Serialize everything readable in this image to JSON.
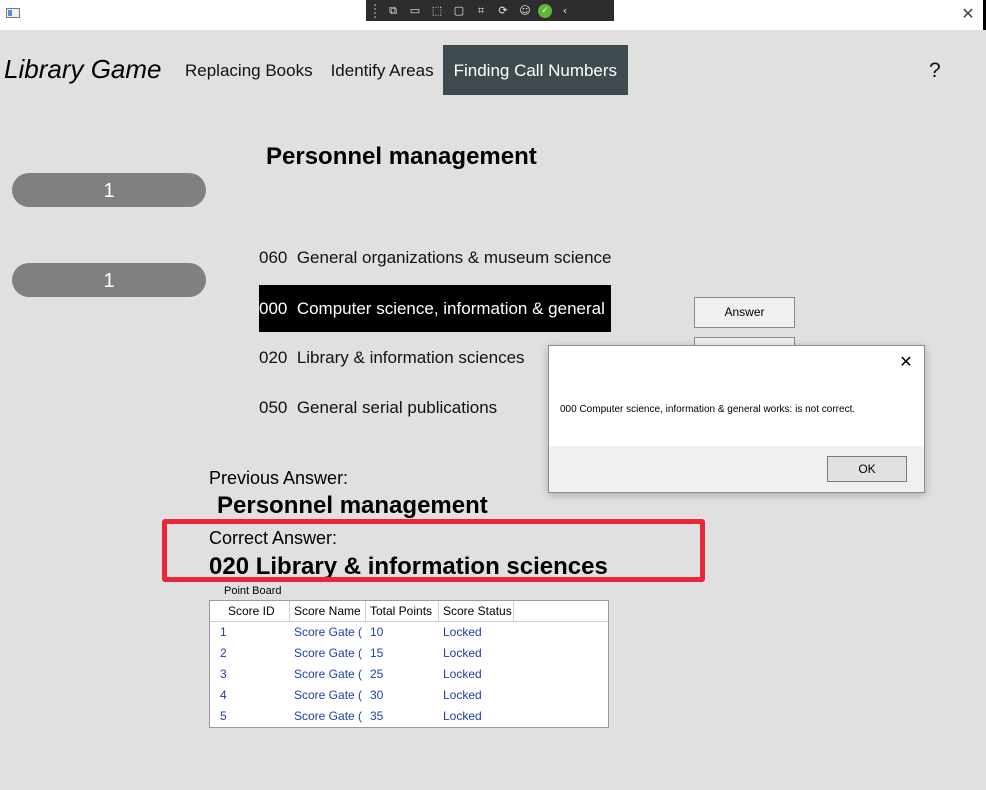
{
  "debug_toolbar": {
    "icons": [
      "live-visual-tree-icon",
      "select-element-icon",
      "display-layout-adorners-icon",
      "track-focus-icon",
      "binding-failures-icon",
      "accessibility-icon",
      "checkmark-icon",
      "collapse-icon"
    ]
  },
  "header": {
    "brand": "Library Game",
    "nav": [
      "Replacing Books",
      "Identify Areas",
      "Finding Call Numbers"
    ],
    "active_nav": "Finding Call Numbers",
    "help": "?"
  },
  "counters": [
    "1",
    "1"
  ],
  "question": "Personnel management",
  "options": [
    {
      "code": "060",
      "label": "General organizations & museum science",
      "selected": false
    },
    {
      "code": "000",
      "label": "Computer science, information & general",
      "selected": true
    },
    {
      "code": "020",
      "label": "Library & information sciences",
      "selected": false
    },
    {
      "code": "050",
      "label": "General serial publications",
      "selected": false
    }
  ],
  "answer_button": "Answer",
  "previous": {
    "label": "Previous Answer:",
    "value": "Personnel management"
  },
  "correct": {
    "label": "Correct Answer:",
    "value": "020  Library & information sciences"
  },
  "point_board": {
    "label": "Point Board",
    "columns": [
      "Score ID",
      "Score Name",
      "Total Points",
      "Score Status"
    ],
    "rows": [
      [
        "1",
        "Score Gate (",
        "10",
        "Locked"
      ],
      [
        "2",
        "Score Gate (",
        "15",
        "Locked"
      ],
      [
        "3",
        "Score Gate (",
        "25",
        "Locked"
      ],
      [
        "4",
        "Score Gate (",
        "30",
        "Locked"
      ],
      [
        "5",
        "Score Gate (",
        "35",
        "Locked"
      ]
    ]
  },
  "dialog": {
    "message": "000  Computer science, information & general works: is not correct.",
    "ok": "OK"
  },
  "colors": {
    "active_nav_bg": "#3f4a4f",
    "counter_bg": "#808080",
    "highlight": "#e8283a",
    "row_text": "#1f3fa8"
  }
}
